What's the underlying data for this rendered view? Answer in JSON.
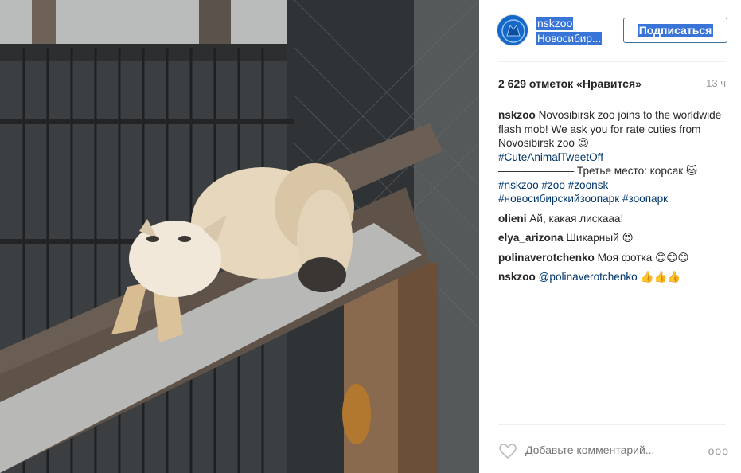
{
  "post": {
    "image_alt": "",
    "header": {
      "username": "nskzoo",
      "location": "Новосибир...",
      "follow_label": "Подписаться"
    },
    "likes_text": "2 629 отметок «Нравится»",
    "time_ago": "13 ч",
    "caption": {
      "user": "nskzoo",
      "text": "Novosibirsk zoo joins to the worldwide flash mob! We ask you for rate cuties from Novosibirsk zoo 😉",
      "hashtag1": "#CuteAnimalTweetOff",
      "line2": "——————— Третье место: корсак 🐱",
      "tags": [
        "#nskzoo",
        "#zoo",
        "#zoonsk",
        "#новосибирскийзоопарк",
        "#зоопарк"
      ]
    },
    "comments": [
      {
        "user": "olieni",
        "text": "Ай, какая лискааа!"
      },
      {
        "user": "elya_arizona",
        "text": "Шикарный 😍"
      },
      {
        "user": "polinaverotchenko",
        "text": "Моя фотка 😊😊😊"
      },
      {
        "user": "nskzoo",
        "mention": "@polinaverotchenko",
        "text": "👍👍👍"
      }
    ],
    "comment_placeholder": "Добавьте комментарий...",
    "more_label": "ooo"
  },
  "colors": {
    "accent": "#3f729b",
    "selection": "#3875d7",
    "link": "#003569",
    "muted": "#999999"
  }
}
